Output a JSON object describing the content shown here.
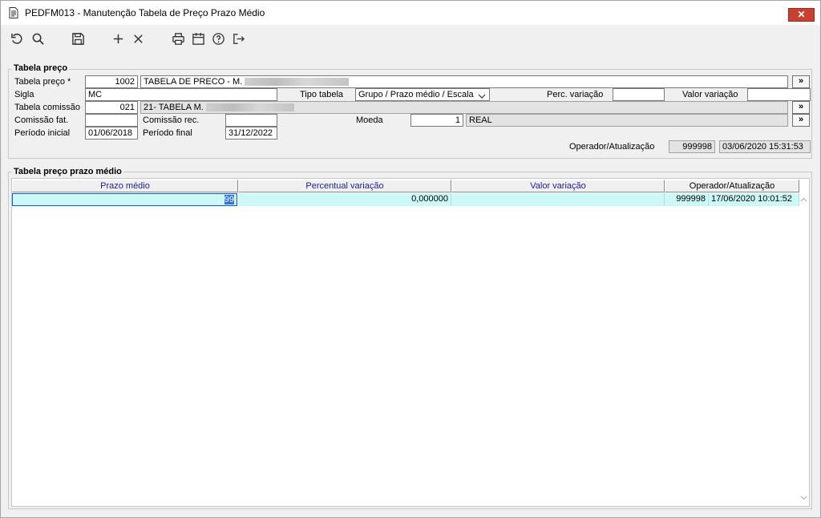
{
  "window": {
    "title": "PEDFM013 - Manutenção Tabela de Preço Prazo Médio",
    "close_label": "✕"
  },
  "toolbar": {
    "icons": [
      "undo-icon",
      "search-icon",
      "save-icon",
      "add-icon",
      "delete-icon",
      "print-icon",
      "calendar-icon",
      "help-icon",
      "exit-icon"
    ]
  },
  "section1": {
    "title": "Tabela preço",
    "tabela_preco_label": "Tabela preço *",
    "tabela_preco_code": "1002",
    "tabela_preco_desc": "TABELA DE PRECO - M.",
    "sigla_label": "Sigla",
    "sigla_value": "MC",
    "tipo_tabela_label": "Tipo tabela",
    "tipo_tabela_value": "Grupo / Prazo médio / Escala",
    "perc_variacao_label": "Perc. variação",
    "perc_variacao_value": "",
    "valor_variacao_label": "Valor variação",
    "valor_variacao_value": "",
    "tabela_comissao_label": "Tabela comissão",
    "tabela_comissao_code": "021",
    "tabela_comissao_desc": "21- TABELA M.",
    "comissao_fat_label": "Comissão fat.",
    "comissao_fat_value": "",
    "comissao_rec_label": "Comissão rec.",
    "comissao_rec_value": "",
    "moeda_label": "Moeda",
    "moeda_code": "1",
    "moeda_desc": "REAL",
    "periodo_inicial_label": "Período inicial",
    "periodo_inicial_value": "01/06/2018",
    "periodo_final_label": "Período final",
    "periodo_final_value": "31/12/2022",
    "operador_label": "Operador/Atualização",
    "operador_value": "999998",
    "atualizacao_value": "03/06/2020 15:31:53",
    "more_label": "»"
  },
  "section2": {
    "title": "Tabela preço prazo médio",
    "columns": [
      "Prazo médio",
      "Percentual variação",
      "Valor variação",
      "Operador/Atualização"
    ],
    "rows": [
      {
        "prazo_medio": "99",
        "percentual": "0,000000",
        "valor": "",
        "operador": "999998",
        "atualizacao": "17/06/2020 10:01:52"
      }
    ]
  },
  "colors": {
    "close_red": "#c84031",
    "header_blue": "#1c1c9c",
    "row_cyan": "#cdf8f8",
    "selection_blue": "#3171d8"
  }
}
